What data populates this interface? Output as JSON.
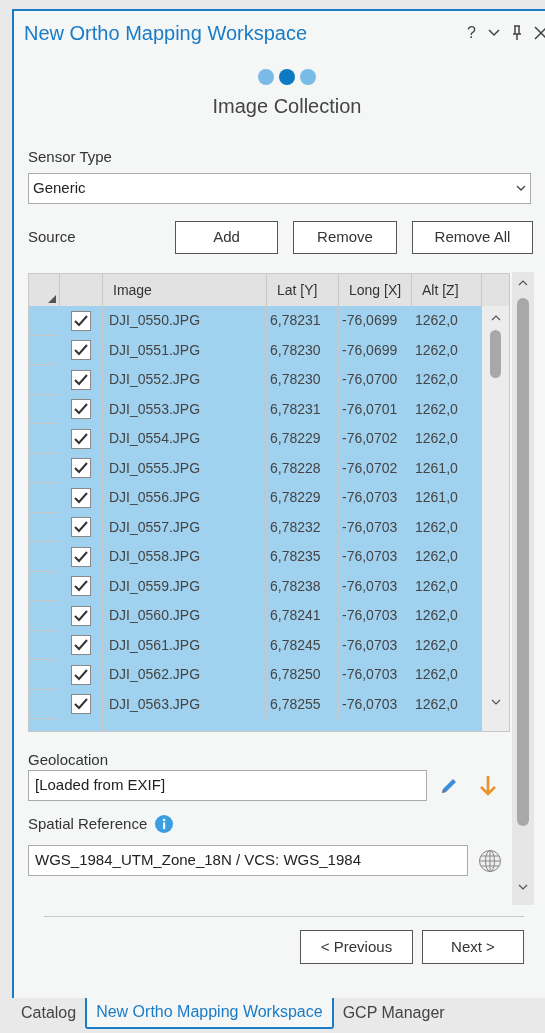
{
  "pane": {
    "title": "New Ortho Mapping Workspace",
    "help": "?"
  },
  "steps": [
    {
      "selected": false
    },
    {
      "selected": true
    },
    {
      "selected": false
    }
  ],
  "step_title": "Image Collection",
  "sensor_type": {
    "label": "Sensor Type",
    "value": "Generic"
  },
  "source": {
    "label": "Source",
    "buttons": [
      "Add",
      "Remove",
      "Remove All"
    ]
  },
  "table": {
    "columns": [
      "Image",
      "Lat [Y]",
      "Long [X]",
      "Alt [Z]"
    ],
    "rows": [
      {
        "checked": true,
        "selected": true,
        "cells": [
          "DJI_0550.JPG",
          "6,78231",
          "-76,0699",
          "1262,0"
        ]
      },
      {
        "checked": true,
        "selected": true,
        "cells": [
          "DJI_0551.JPG",
          "6,78230",
          "-76,0699",
          "1262,0"
        ]
      },
      {
        "checked": true,
        "selected": true,
        "cells": [
          "DJI_0552.JPG",
          "6,78230",
          "-76,0700",
          "1262,0"
        ]
      },
      {
        "checked": true,
        "selected": true,
        "cells": [
          "DJI_0553.JPG",
          "6,78231",
          "-76,0701",
          "1262,0"
        ]
      },
      {
        "checked": true,
        "selected": true,
        "cells": [
          "DJI_0554.JPG",
          "6,78229",
          "-76,0702",
          "1262,0"
        ]
      },
      {
        "checked": true,
        "selected": true,
        "cells": [
          "DJI_0555.JPG",
          "6,78228",
          "-76,0702",
          "1261,0"
        ]
      },
      {
        "checked": true,
        "selected": true,
        "cells": [
          "DJI_0556.JPG",
          "6,78229",
          "-76,0703",
          "1261,0"
        ]
      },
      {
        "checked": true,
        "selected": true,
        "cells": [
          "DJI_0557.JPG",
          "6,78232",
          "-76,0703",
          "1262,0"
        ]
      },
      {
        "checked": true,
        "selected": true,
        "cells": [
          "DJI_0558.JPG",
          "6,78235",
          "-76,0703",
          "1262,0"
        ]
      },
      {
        "checked": true,
        "selected": true,
        "cells": [
          "DJI_0559.JPG",
          "6,78238",
          "-76,0703",
          "1262,0"
        ]
      },
      {
        "checked": true,
        "selected": true,
        "cells": [
          "DJI_0560.JPG",
          "6,78241",
          "-76,0703",
          "1262,0"
        ]
      },
      {
        "checked": true,
        "selected": true,
        "cells": [
          "DJI_0561.JPG",
          "6,78245",
          "-76,0703",
          "1262,0"
        ]
      },
      {
        "checked": true,
        "selected": true,
        "cells": [
          "DJI_0562.JPG",
          "6,78250",
          "-76,0703",
          "1262,0"
        ]
      },
      {
        "checked": true,
        "selected": true,
        "cells": [
          "DJI_0563.JPG",
          "6,78255",
          "-76,0703",
          "1262,0"
        ]
      }
    ]
  },
  "geolocation": {
    "label": "Geolocation",
    "value": "[Loaded from EXIF]"
  },
  "spatial_reference": {
    "label": "Spatial Reference",
    "value": "WGS_1984_UTM_Zone_18N / VCS: WGS_1984"
  },
  "footer_buttons": [
    "< Previous",
    "Next >"
  ],
  "tabs": [
    {
      "label": "Catalog",
      "selected": false
    },
    {
      "label": "New Ortho Mapping Workspace",
      "selected": true
    },
    {
      "label": "GCP Manager",
      "selected": false
    }
  ]
}
